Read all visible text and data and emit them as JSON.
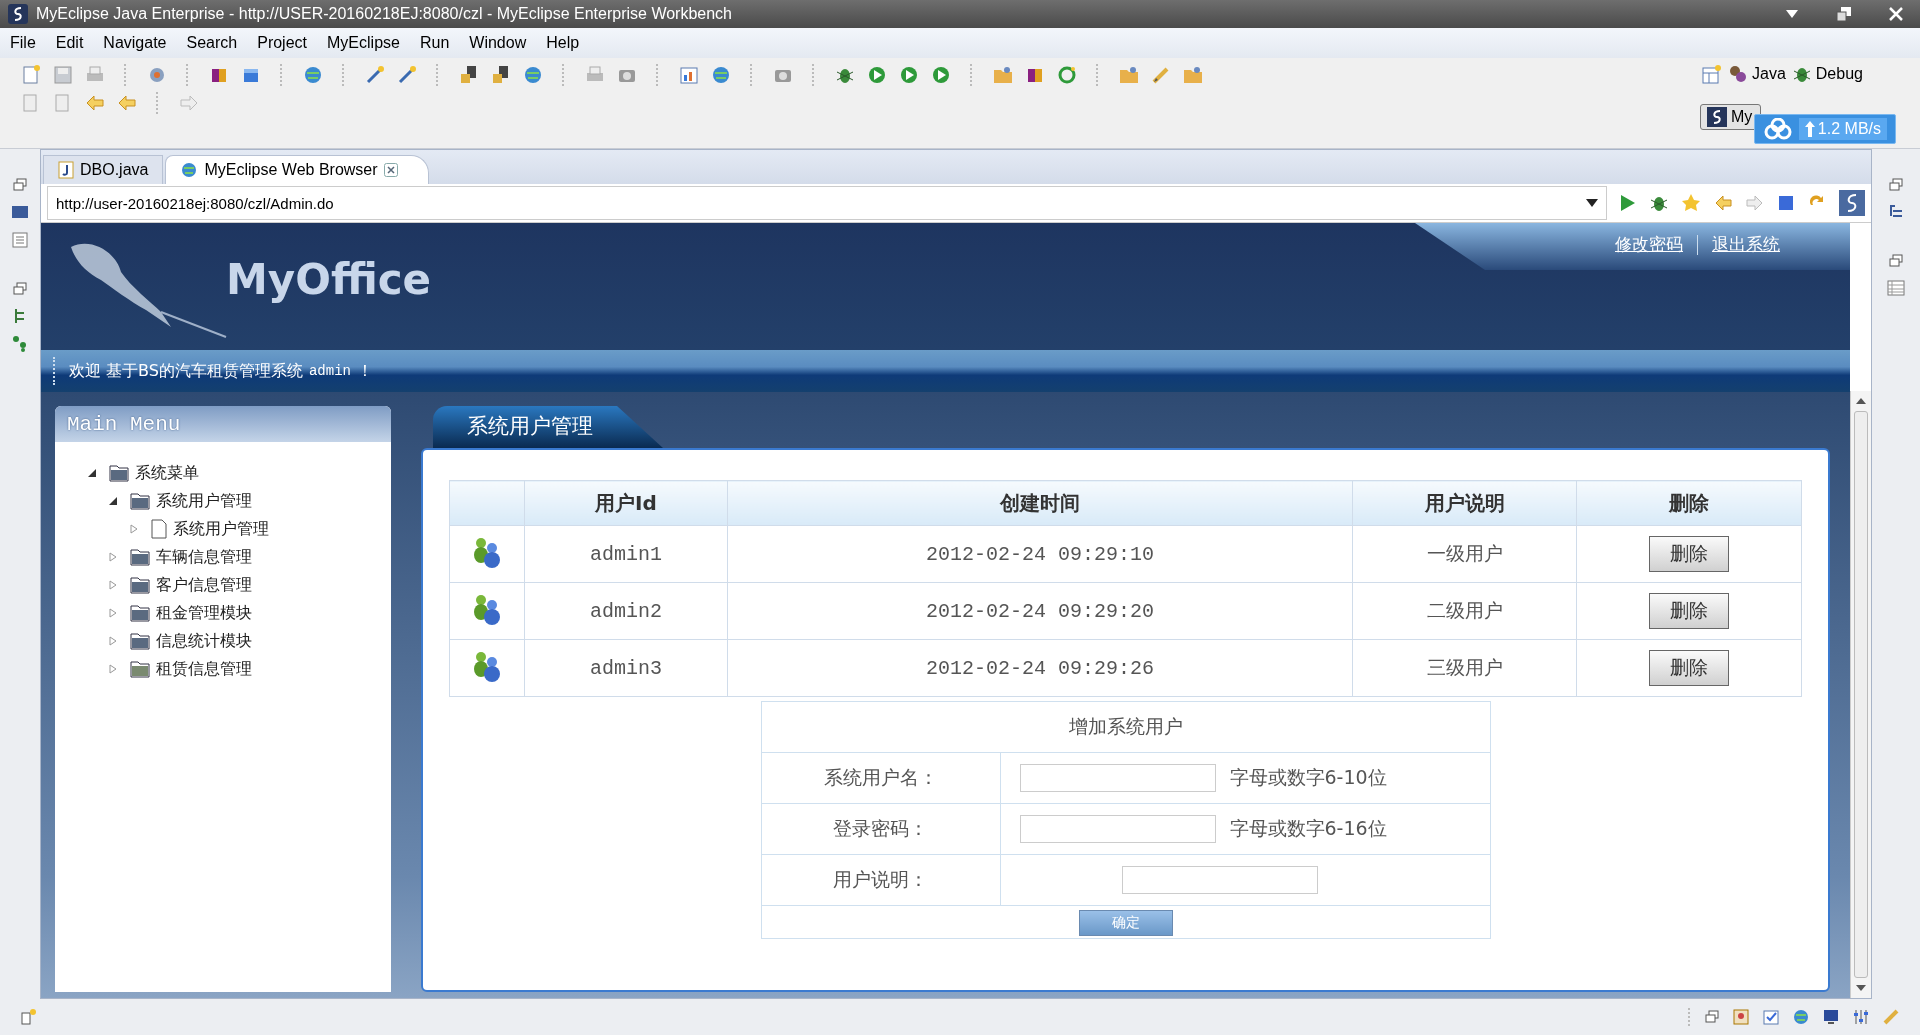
{
  "window": {
    "title": "MyEclipse Java Enterprise - http://USER-20160218EJ:8080/czl - MyEclipse Enterprise Workbench"
  },
  "menu": [
    "File",
    "Edit",
    "Navigate",
    "Search",
    "Project",
    "MyEclipse",
    "Run",
    "Window",
    "Help"
  ],
  "perspectives": [
    {
      "label": "Java",
      "kind": "java"
    },
    {
      "label": "Debug",
      "kind": "debug"
    },
    {
      "label": "My",
      "kind": "myeclipse"
    }
  ],
  "upload_widget": {
    "speed": "1.2 MB/s"
  },
  "editor_tabs": [
    {
      "label": "DBO.java",
      "selected": false,
      "closable": false
    },
    {
      "label": "MyEclipse Web Browser",
      "selected": true,
      "closable": true
    }
  ],
  "address_bar": {
    "value": "http://user-20160218ej:8080/czl/Admin.do"
  },
  "page": {
    "logo": "MyOffice",
    "header_links": [
      "修改密码",
      "退出系统"
    ],
    "welcome": {
      "greeting": "欢迎 基于BS的汽车租赁管理系统",
      "user": "admin",
      "suffix": "！"
    },
    "main_menu": {
      "title": "Main Menu",
      "tree": [
        {
          "label": "系统菜单",
          "kind": "folder",
          "expanded": true,
          "children": [
            {
              "label": "系统用户管理",
              "kind": "folder",
              "expanded": true,
              "children": [
                {
                  "label": "系统用户管理",
                  "kind": "page",
                  "expanded": false
                }
              ]
            },
            {
              "label": "车辆信息管理",
              "kind": "folder",
              "expanded": false
            },
            {
              "label": "客户信息管理",
              "kind": "folder",
              "expanded": false
            },
            {
              "label": "租金管理模块",
              "kind": "folder",
              "expanded": false
            },
            {
              "label": "信息统计模块",
              "kind": "folder",
              "expanded": false
            },
            {
              "label": "租赁信息管理",
              "kind": "image-folder",
              "expanded": false
            }
          ]
        }
      ]
    },
    "section_tab": "系统用户管理",
    "table": {
      "columns": [
        "用户Id",
        "创建时间",
        "用户说明",
        "删除"
      ],
      "rows": [
        {
          "user_id": "admin1",
          "created": "2012-02-24 09:29:10",
          "description": "一级用户",
          "action": "删除"
        },
        {
          "user_id": "admin2",
          "created": "2012-02-24 09:29:20",
          "description": "二级用户",
          "action": "删除"
        },
        {
          "user_id": "admin3",
          "created": "2012-02-24 09:29:26",
          "description": "三级用户",
          "action": "删除"
        }
      ]
    },
    "add_form": {
      "title": "增加系统用户",
      "fields": [
        {
          "label": "系统用户名：",
          "hint": "字母或数字6-10位"
        },
        {
          "label": "登录密码：",
          "hint": "字母或数字6-16位"
        },
        {
          "label": "用户说明："
        }
      ],
      "submit": "确定"
    }
  }
}
